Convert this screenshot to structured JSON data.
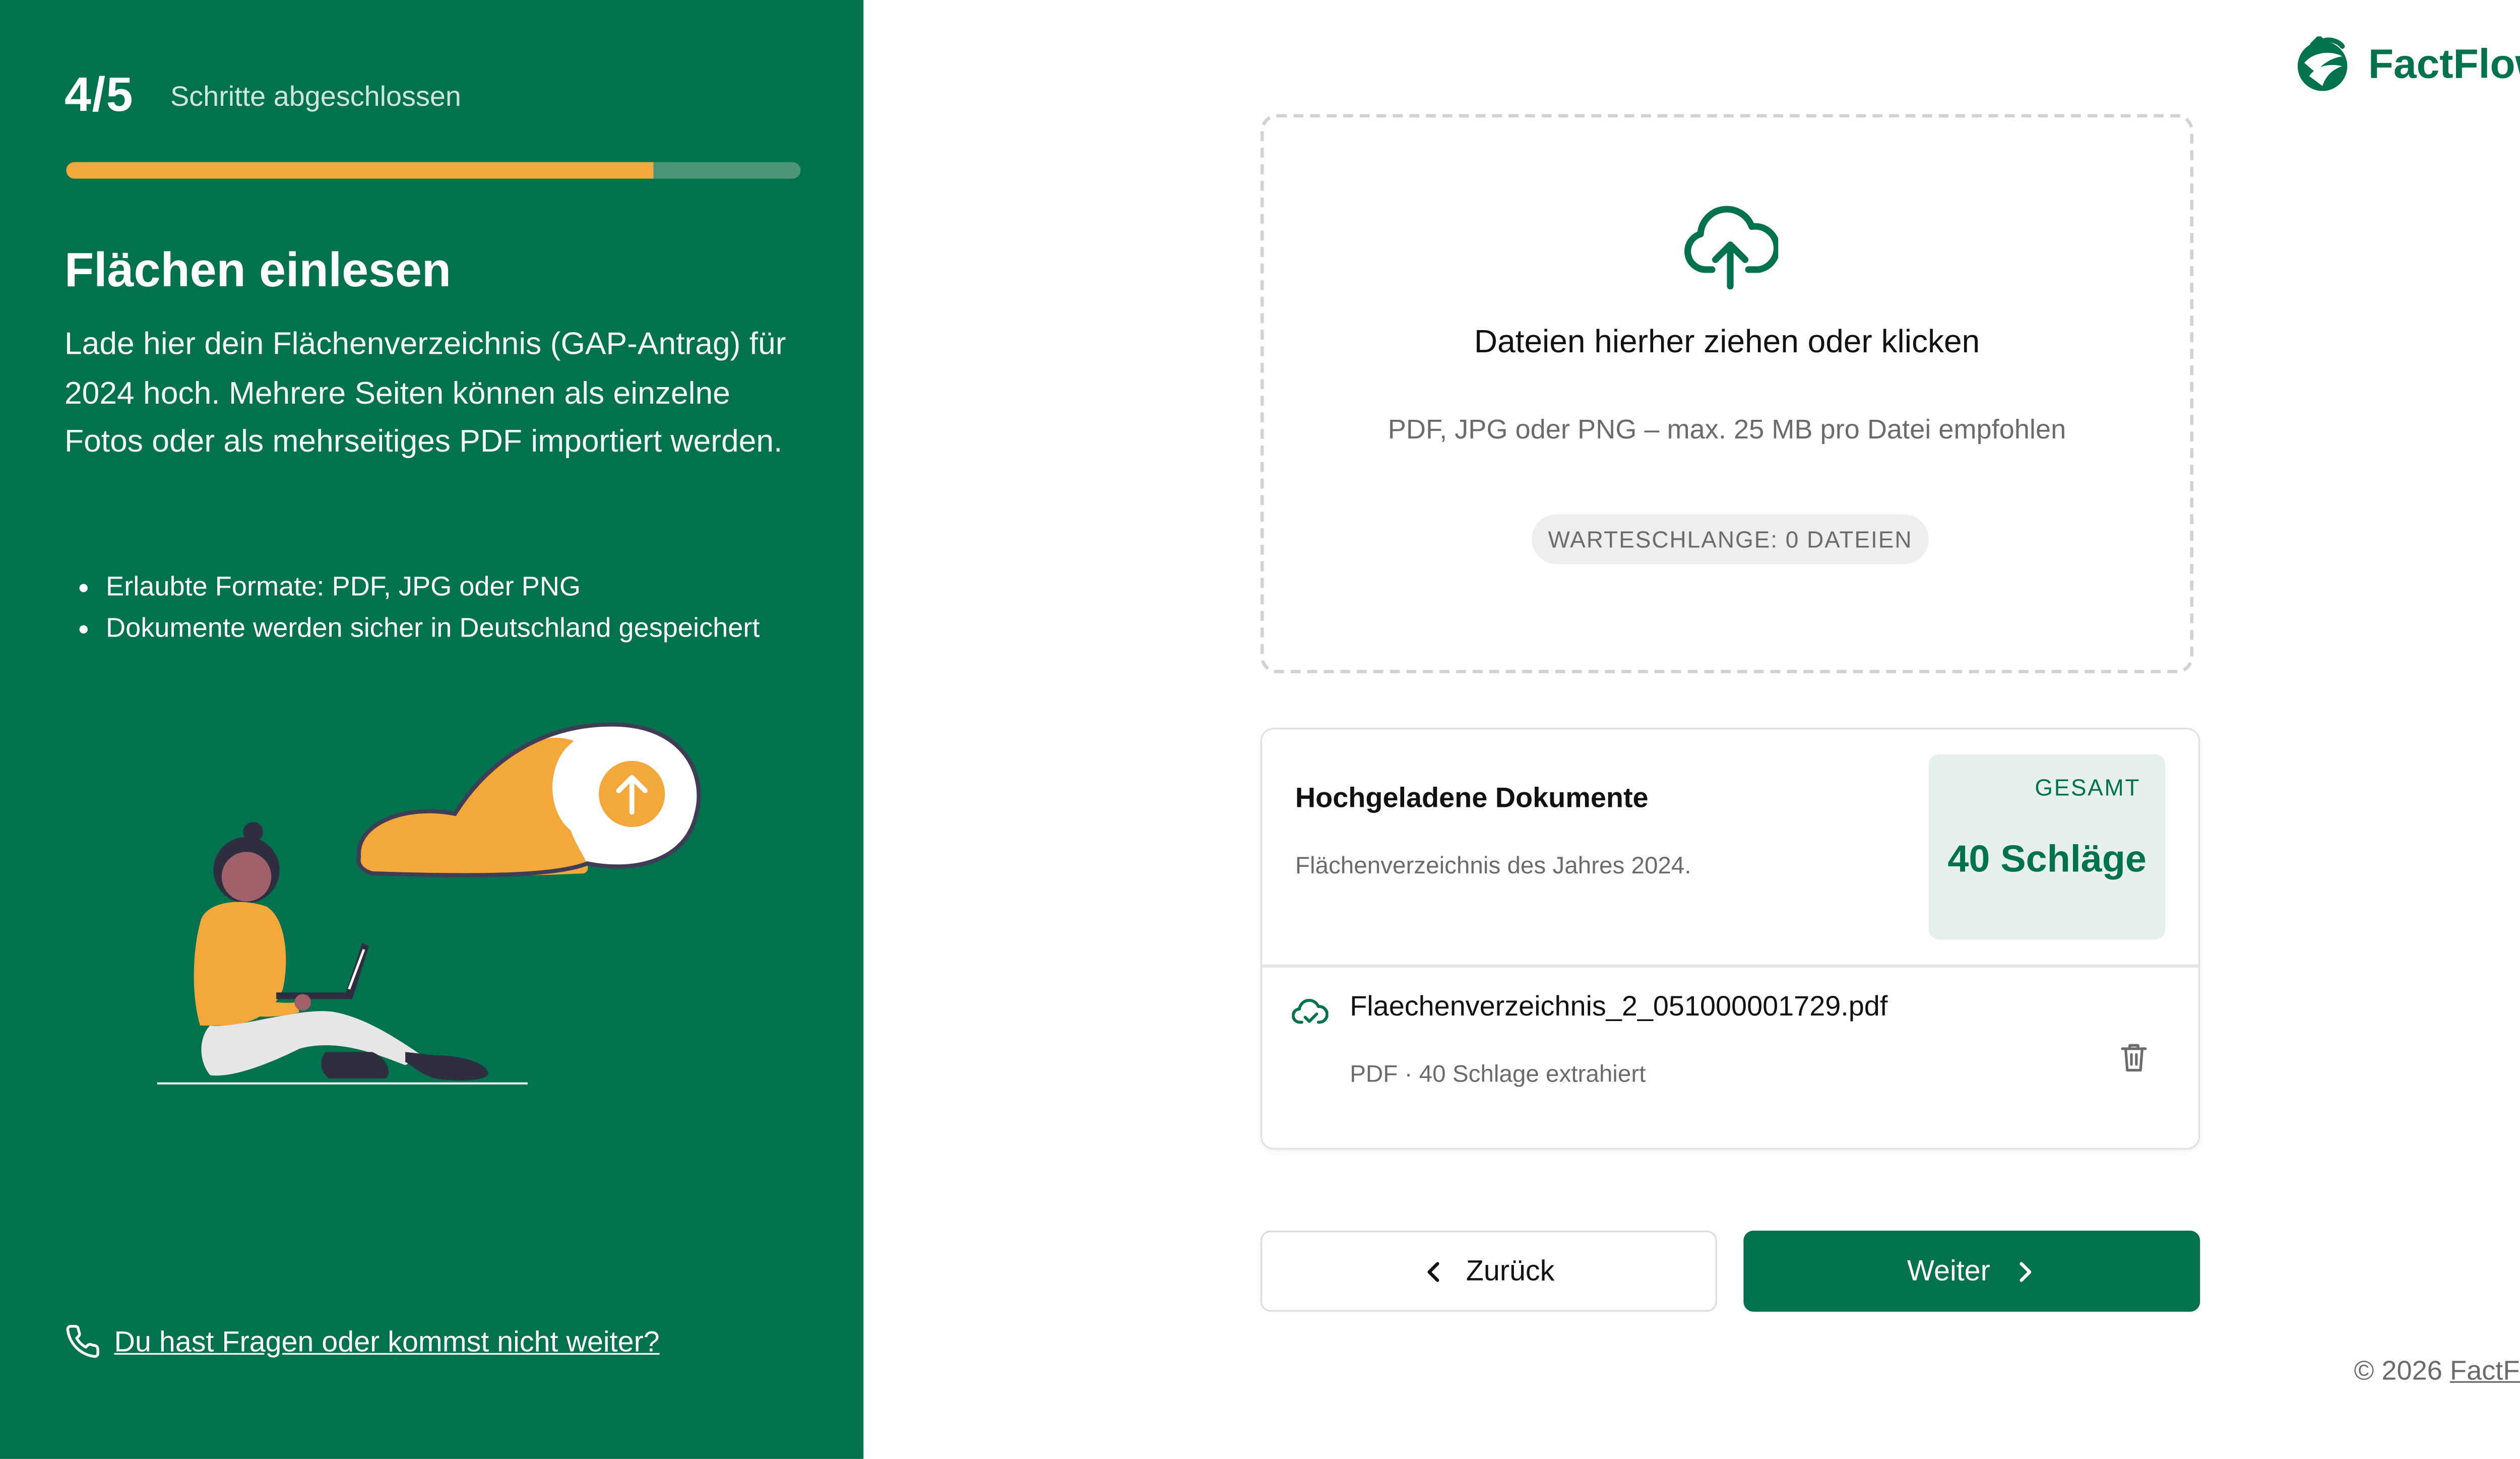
{
  "progress": {
    "count": "4/5",
    "label": "Schritte abgeschlossen",
    "fraction": 0.8
  },
  "step": {
    "title": "Flächen einlesen",
    "description": "Lade hier dein Flächenverzeichnis (GAP-Antrag) für 2024 hoch. Mehrere Seiten können als einzelne Fotos oder als mehrseitiges PDF importiert werden.",
    "bullets": [
      "Erlaubte Formate: PDF, JPG oder PNG",
      "Dokumente werden sicher in Deutschland gespeichert"
    ]
  },
  "help": {
    "label": "Du hast Fragen oder kommst nicht weiter?",
    "icon": "phone-icon"
  },
  "brand": {
    "name": "FactFlow",
    "color": "#02714d"
  },
  "dropzone": {
    "icon": "cloud-upload-icon",
    "title": "Dateien hierher ziehen oder klicken",
    "hint": "PDF, JPG oder PNG – max. 25 MB pro Datei empfohlen",
    "queue": "WARTESCHLANGE: 0 DATEIEN"
  },
  "documents": {
    "title": "Hochgeladene Dokumente",
    "subtitle": "Flächenverzeichnis des Jahres 2024.",
    "total_label": "GESAMT",
    "total_value": "40 Schläge",
    "files": [
      {
        "name": "Flaechenverzeichnis_2_051000001729.pdf",
        "meta": "PDF · 40 Schlage extrahiert",
        "icon": "cloud-check-icon"
      }
    ]
  },
  "nav": {
    "back_label": "Zurück",
    "next_label": "Weiter"
  },
  "footer": {
    "copyright_prefix": "© 2026",
    "copyright_link": "FactFlow"
  },
  "colors": {
    "primary": "#02714d",
    "accent": "#f2a83a",
    "muted": "#6b6b6b"
  }
}
